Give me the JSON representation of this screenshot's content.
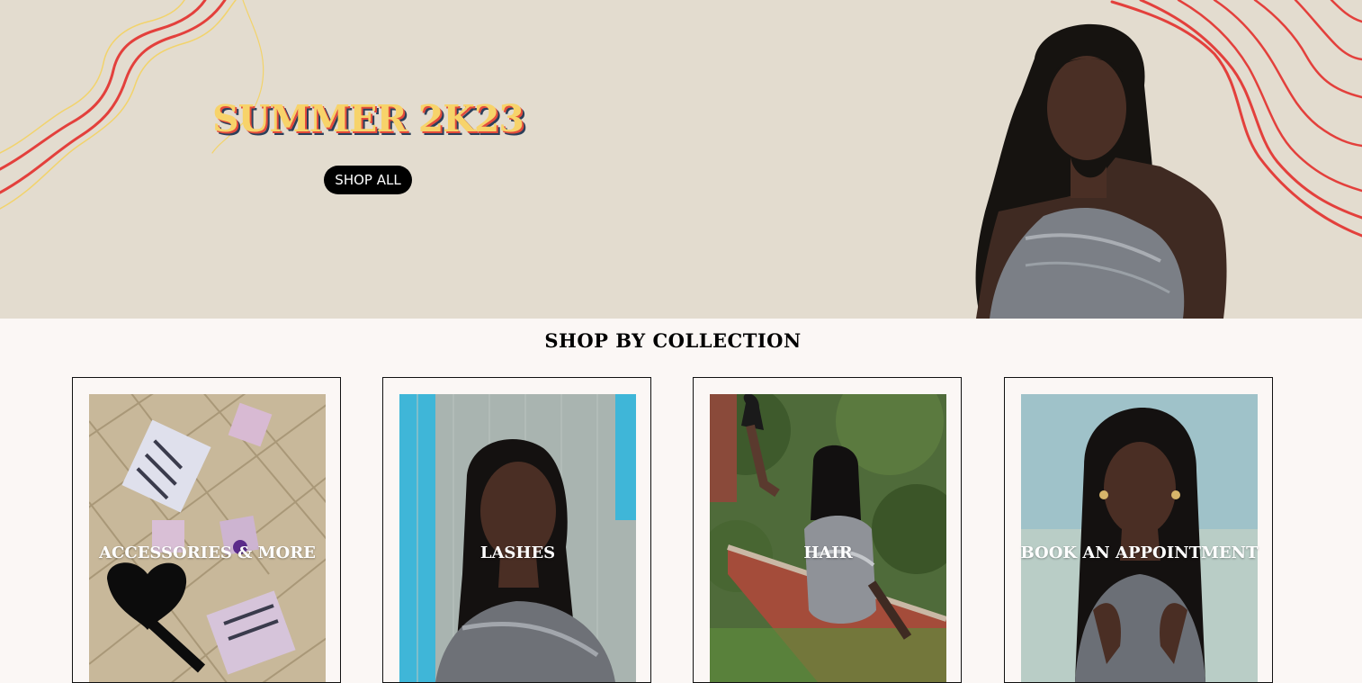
{
  "hero": {
    "title": "SUMMER 2K23",
    "cta_label": "SHOP ALL"
  },
  "section": {
    "title": "SHOP BY COLLECTION"
  },
  "collections": [
    {
      "label": "ACCESSORIES & MORE"
    },
    {
      "label": "LASHES"
    },
    {
      "label": "HAIR"
    },
    {
      "label": "BOOK AN APPOINTMENT"
    }
  ],
  "colors": {
    "hero_background": "#e3dccf",
    "page_background": "#fbf7f5",
    "title_fill": "#f7d36a",
    "title_shadow_red": "#e34b3c",
    "title_shadow_navy": "#2b3f5a",
    "line_red": "#e3403c",
    "line_yellow": "#f2d36b",
    "button": "#000000"
  }
}
